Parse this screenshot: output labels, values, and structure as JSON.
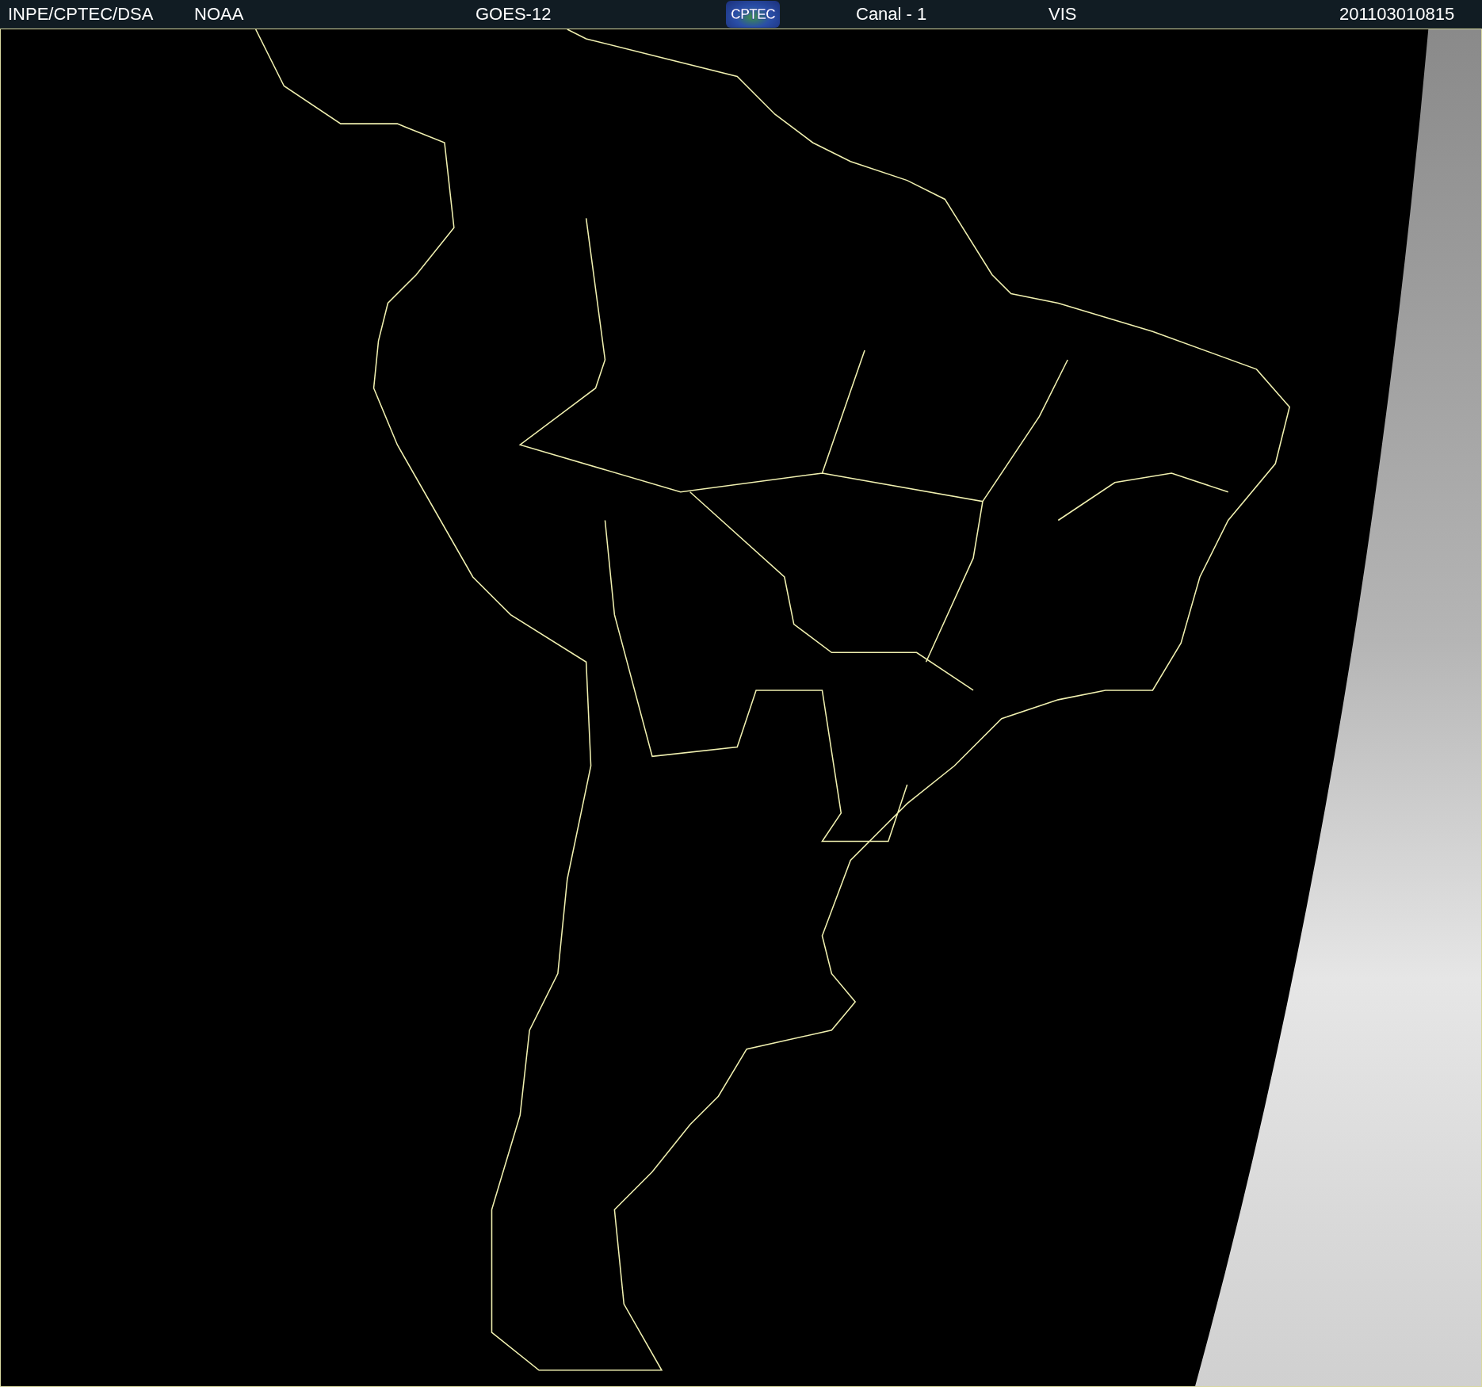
{
  "header": {
    "items": [
      {
        "kind": "text",
        "text": "INPE/CPTEC/DSA"
      },
      {
        "kind": "text",
        "text": "NOAA"
      },
      {
        "kind": "text",
        "text": "GOES-12"
      },
      {
        "kind": "logo",
        "text": "CPTEC"
      },
      {
        "kind": "text",
        "text": "Canal - 1"
      },
      {
        "kind": "text",
        "text": "VIS"
      },
      {
        "kind": "text",
        "text": "201103010815"
      }
    ]
  }
}
